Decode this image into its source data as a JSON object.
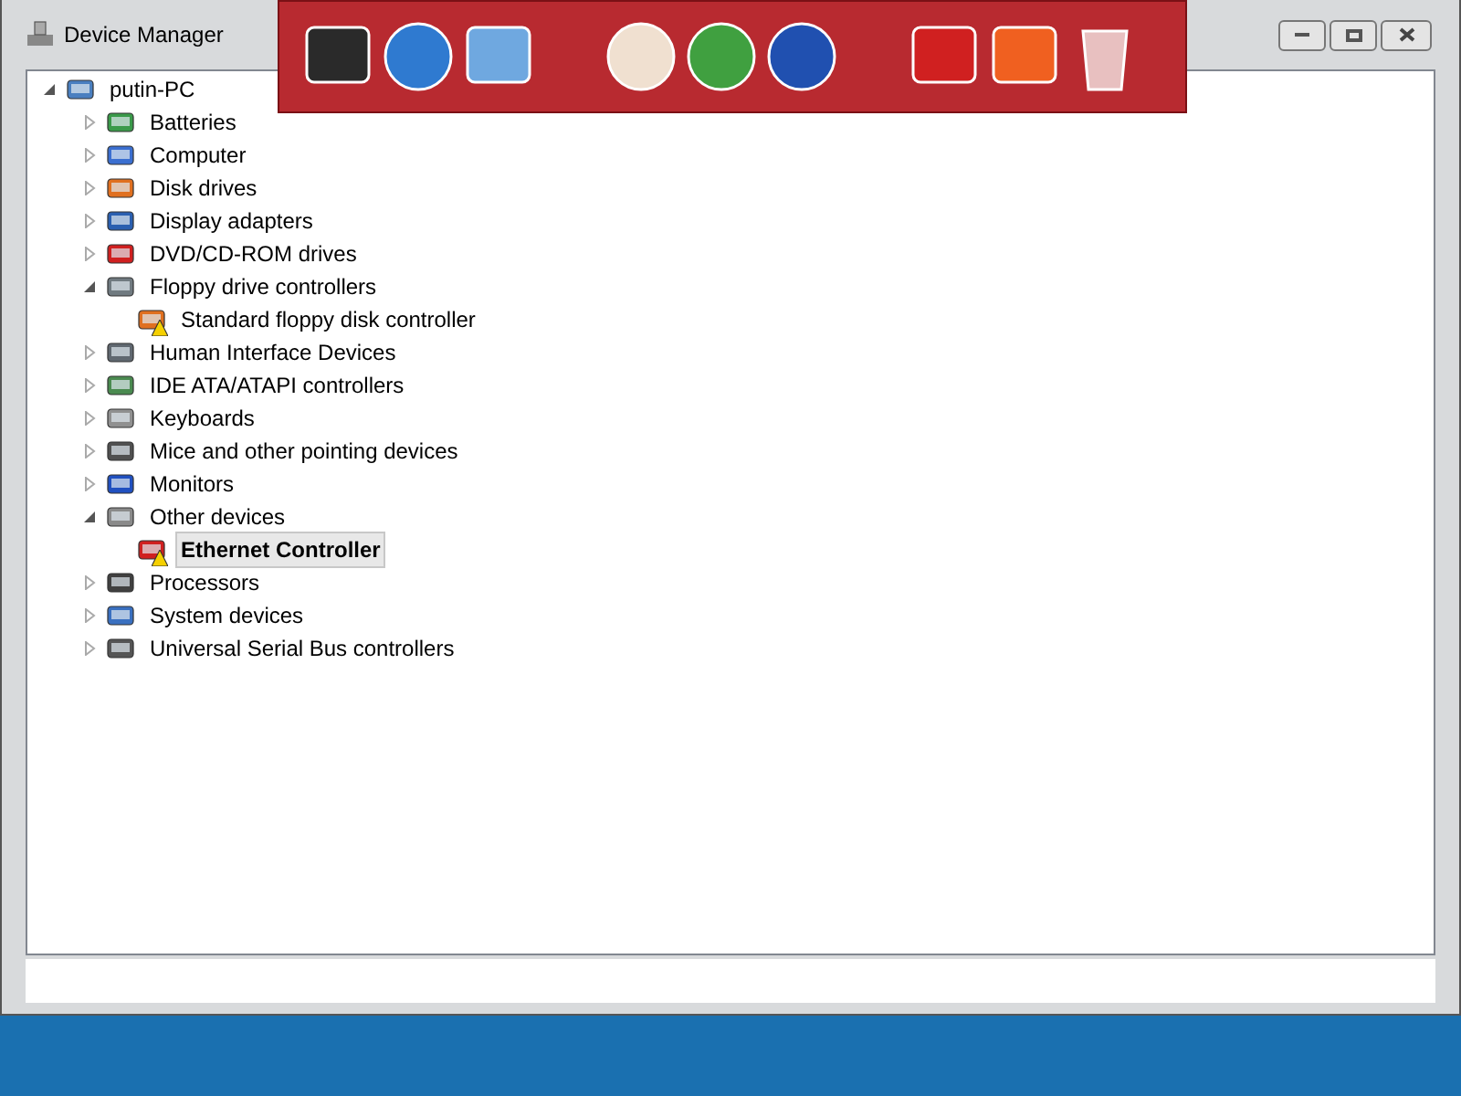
{
  "window": {
    "title": "Device Manager"
  },
  "tree": [
    {
      "label": "putin-PC",
      "expanded": true,
      "selected": false,
      "children": [
        {
          "label": "Batteries",
          "expanded": false,
          "selected": false
        },
        {
          "label": "Computer",
          "expanded": false,
          "selected": false
        },
        {
          "label": "Disk drives",
          "expanded": false,
          "selected": false
        },
        {
          "label": "Display adapters",
          "expanded": false,
          "selected": false
        },
        {
          "label": "DVD/CD-ROM drives",
          "expanded": false,
          "selected": false
        },
        {
          "label": "Floppy drive controllers",
          "expanded": true,
          "selected": false,
          "children": [
            {
              "label": "Standard floppy disk controller",
              "selected": false,
              "warning": true
            }
          ]
        },
        {
          "label": "Human Interface Devices",
          "expanded": false,
          "selected": false
        },
        {
          "label": "IDE ATA/ATAPI controllers",
          "expanded": false,
          "selected": false
        },
        {
          "label": "Keyboards",
          "expanded": false,
          "selected": false
        },
        {
          "label": "Mice and other pointing devices",
          "expanded": false,
          "selected": false
        },
        {
          "label": "Monitors",
          "expanded": false,
          "selected": false
        },
        {
          "label": "Other devices",
          "expanded": true,
          "selected": false,
          "children": [
            {
              "label": "Ethernet Controller",
              "selected": true,
              "warning": true
            }
          ]
        },
        {
          "label": "Processors",
          "expanded": false,
          "selected": false
        },
        {
          "label": "System devices",
          "expanded": false,
          "selected": false
        },
        {
          "label": "Universal Serial Bus controllers",
          "expanded": false,
          "selected": false
        }
      ]
    }
  ]
}
